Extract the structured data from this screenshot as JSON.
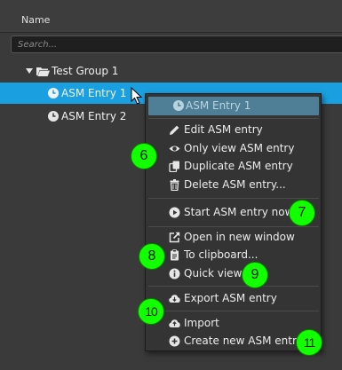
{
  "header": {
    "column_name": "Name"
  },
  "search": {
    "placeholder": "Search..."
  },
  "tree": {
    "group": {
      "label": "Test Group 1"
    },
    "entries": [
      {
        "label": "ASM Entry 1",
        "selected": true
      },
      {
        "label": "ASM Entry 2",
        "selected": false
      }
    ]
  },
  "context_menu": {
    "header": {
      "label": "ASM Entry 1",
      "icon": "clock-icon"
    },
    "items": [
      {
        "label": "Edit ASM entry",
        "icon": "pencil-icon"
      },
      {
        "label": "Only view ASM entry",
        "icon": "eye-icon"
      },
      {
        "label": "Duplicate ASM entry",
        "icon": "copy-icon"
      },
      {
        "label": "Delete ASM entry...",
        "icon": "trash-icon"
      },
      {
        "label": "Start ASM entry now",
        "icon": "play-circle-icon"
      },
      {
        "label": "Open in new window",
        "icon": "external-link-icon"
      },
      {
        "label": "To clipboard...",
        "icon": "clipboard-icon"
      },
      {
        "label": "Quick view",
        "icon": "info-circle-icon"
      },
      {
        "label": "Export ASM entry",
        "icon": "cloud-download-icon"
      },
      {
        "label": "Import",
        "icon": "cloud-upload-icon"
      },
      {
        "label": "Create new ASM entry",
        "icon": "plus-circle-icon"
      }
    ]
  },
  "annotations": [
    "6",
    "7",
    "8",
    "9",
    "10",
    "11"
  ],
  "colors": {
    "background": "#3a3a3a",
    "selection": "#1aa0e0",
    "menu_background": "#343434",
    "menu_header": "#4f7f96",
    "badge": "#12ff00"
  }
}
